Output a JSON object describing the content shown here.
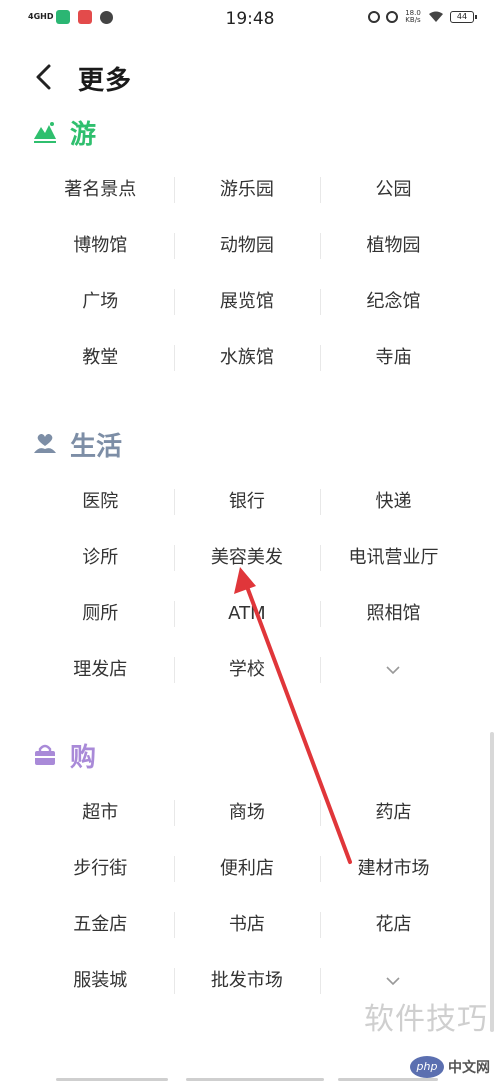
{
  "status_bar": {
    "network": "4GHD",
    "time": "19:48",
    "speed": "18.0 KB/s",
    "battery": "44"
  },
  "header": {
    "title": "更多"
  },
  "sections": [
    {
      "title": "游",
      "color": "#2fbf6e",
      "icon": "mountain-icon",
      "rows": [
        [
          "著名景点",
          "游乐园",
          "公园"
        ],
        [
          "博物馆",
          "动物园",
          "植物园"
        ],
        [
          "广场",
          "展览馆",
          "纪念馆"
        ],
        [
          "教堂",
          "水族馆",
          "寺庙"
        ]
      ]
    },
    {
      "title": "生活",
      "color": "#7d8ea6",
      "icon": "heart-hand-icon",
      "rows": [
        [
          "医院",
          "银行",
          "快递"
        ],
        [
          "诊所",
          "美容美发",
          "电讯营业厅"
        ],
        [
          "厕所",
          "ATM",
          "照相馆"
        ],
        [
          "理发店",
          "学校",
          ""
        ]
      ]
    },
    {
      "title": "购",
      "color": "#a98ad8",
      "icon": "shopping-bag-icon",
      "rows": [
        [
          "超市",
          "商场",
          "药店"
        ],
        [
          "步行街",
          "便利店",
          "建材市场"
        ],
        [
          "五金店",
          "书店",
          "花店"
        ],
        [
          "服装城",
          "批发市场",
          ""
        ]
      ]
    }
  ],
  "watermark": {
    "text": "软件技巧",
    "badge_php": "php",
    "badge_cn": "中文网"
  }
}
